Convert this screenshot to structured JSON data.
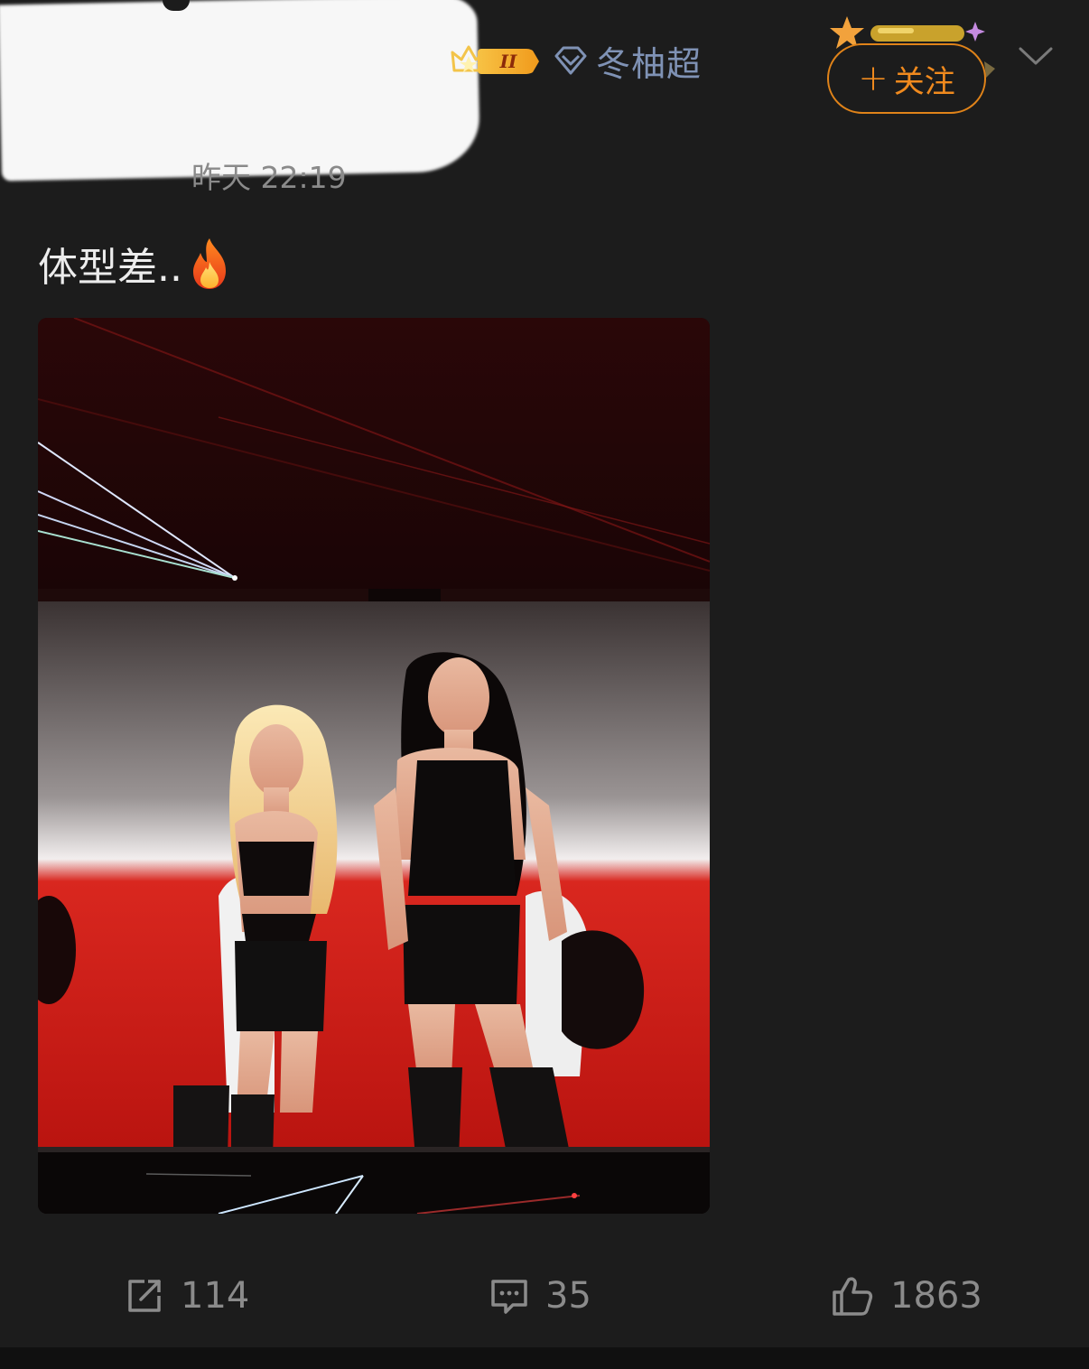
{
  "header": {
    "level_badge": "II",
    "chaohua_label": "冬柚超",
    "follow_label": "关注",
    "follow_plus": "+",
    "timestamp": "昨天 22:19"
  },
  "post": {
    "text": "体型差..",
    "emoji": "fire-emoji",
    "image": {
      "description_icon": "concert-photo"
    }
  },
  "actions": {
    "repost_count": "114",
    "comment_count": "35",
    "like_count": "1863"
  },
  "colors": {
    "background": "#1c1c1c",
    "accent_orange": "#f08a1e",
    "chaohua_blue": "#7f92b5",
    "muted_text": "#8b8b8b"
  }
}
